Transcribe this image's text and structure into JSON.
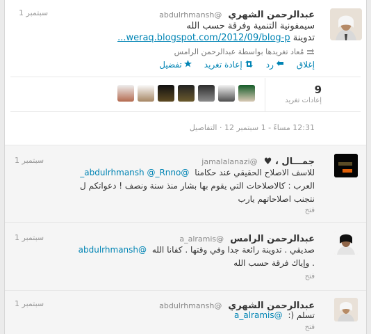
{
  "main_tweet": {
    "author_name": "عبدالرحمن الشهري",
    "author_handle": "@abdulrhmansh",
    "time": "1 سبتمبر",
    "text": "سيمفونية التنمية وفرقة حسب الله",
    "link_text": "weraq.blogspot.com/2012/09/blog-p...",
    "link_suffix": "تدوينة",
    "retweeted_by": "مُعاد تغريدها بواسطة عبدالرحمن الرامس",
    "actions": {
      "close": "إغلاق",
      "reply": "رد",
      "retweet": "إعادة تغريد",
      "favorite": "تفضيل"
    },
    "retweet_count": "9",
    "retweet_label": "إعادات تغريد",
    "timestamp": "12:31 مساءً - 1 سبتمبر 12",
    "details": "التفاصيل"
  },
  "replies": [
    {
      "author_name": "جمـــال ، ♥",
      "author_handle": "@jamalalanazi",
      "time": "1 سبتمبر",
      "mentions": "@abdulrhmansh @_Rnno_",
      "text_1": "للاسف الاصلاح الحقيقي عند حكامنا",
      "text_2": "العرب : كالاصلاحات التي يقوم بها بشار منذ سنة ونصف ! دعواتكم ل",
      "text_3": "نتجنب اصلاحاتهم يارب",
      "open": "فتح"
    },
    {
      "author_name": "عبدالرحمن الرامس",
      "author_handle": "@a_alramis",
      "time": "1 سبتمبر",
      "mentions": "@abdulrhmansh",
      "text_1": "صديقي . تدوينة رائعة جدا وفي وقتها . كفانا الله",
      "text_2": ". وإياك فرقة حسب الله",
      "open": "فتح"
    },
    {
      "author_name": "عبدالرحمن الشهري",
      "author_handle": "@abdulrhmansh",
      "time": "1 سبتمبر",
      "mentions": "@a_alramis",
      "text_1": "تسلم (:",
      "open": "فتح"
    }
  ],
  "colors": {
    "link": "#0084b4",
    "muted": "#999999",
    "reply_bg": "#f5f5f5"
  }
}
